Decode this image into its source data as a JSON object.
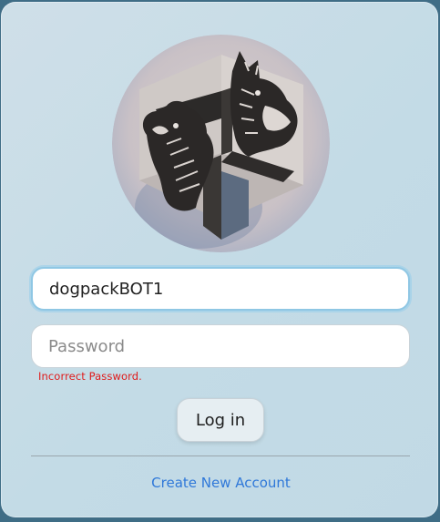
{
  "login": {
    "username_value": "dogpackBOT1",
    "password_placeholder": "Password",
    "error_message": "Incorrect Password.",
    "login_button_label": "Log in",
    "create_account_link": "Create New Account"
  },
  "logo": {
    "icon": "dogpack-logo-icon"
  },
  "colors": {
    "card_background": "#c5dce7",
    "error_text": "#e01b1b",
    "link_text": "#2f78d9",
    "focus_ring": "#8fc7e4"
  }
}
